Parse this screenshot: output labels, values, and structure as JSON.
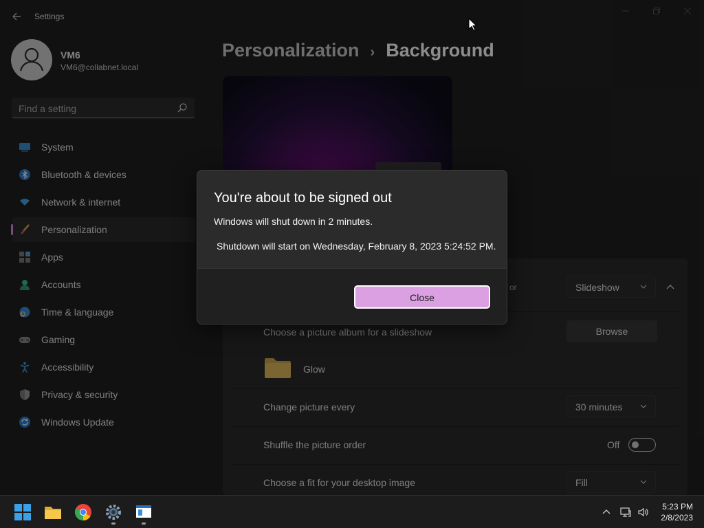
{
  "window": {
    "title": "Settings",
    "back_icon": "back-arrow-icon"
  },
  "user": {
    "name": "VM6",
    "email": "VM6@collabnet.local"
  },
  "search": {
    "placeholder": "Find a setting"
  },
  "sidebar": {
    "items": [
      {
        "label": "System",
        "icon": "monitor-icon",
        "active": false
      },
      {
        "label": "Bluetooth & devices",
        "icon": "bluetooth-icon",
        "active": false
      },
      {
        "label": "Network & internet",
        "icon": "wifi-icon",
        "active": false
      },
      {
        "label": "Personalization",
        "icon": "brush-icon",
        "active": true
      },
      {
        "label": "Apps",
        "icon": "apps-icon",
        "active": false
      },
      {
        "label": "Accounts",
        "icon": "person-icon",
        "active": false
      },
      {
        "label": "Time & language",
        "icon": "clock-globe-icon",
        "active": false
      },
      {
        "label": "Gaming",
        "icon": "gamepad-icon",
        "active": false
      },
      {
        "label": "Accessibility",
        "icon": "accessibility-icon",
        "active": false
      },
      {
        "label": "Privacy & security",
        "icon": "shield-icon",
        "active": false
      },
      {
        "label": "Windows Update",
        "icon": "update-icon",
        "active": false
      }
    ]
  },
  "breadcrumb": {
    "parent": "Personalization",
    "separator": "›",
    "current": "Background"
  },
  "background": {
    "personalize_partial": "or",
    "personalize_value": "Slideshow",
    "album_label": "Choose a picture album for a slideshow",
    "browse_label": "Browse",
    "folder_name": "Glow",
    "interval_label": "Change picture every",
    "interval_value": "30 minutes",
    "shuffle_label": "Shuffle the picture order",
    "shuffle_state": "Off",
    "fit_label": "Choose a fit for your desktop image",
    "fit_value": "Fill"
  },
  "dialog": {
    "title": "You're about to be signed out",
    "message": "Windows will shut down in 2 minutes.",
    "detail": "Shutdown will start on Wednesday, February 8, 2023 5:24:52 PM.",
    "close_label": "Close"
  },
  "taskbar": {
    "apps": [
      "windows-start-icon",
      "file-explorer-icon",
      "chrome-icon",
      "settings-gear-icon",
      "window-app-icon"
    ],
    "time": "5:23 PM",
    "date": "2/8/2023"
  },
  "colors": {
    "accent": "#d98be0",
    "close_button": "#dba0e2",
    "background": "#202020"
  }
}
